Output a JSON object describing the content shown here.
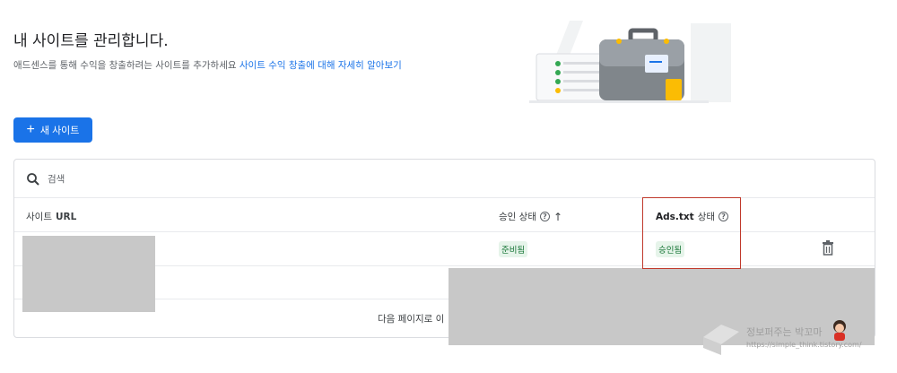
{
  "header": {
    "title": "내 사이트를 관리합니다.",
    "subtitle": "애드센스를 통해 수익을 창출하려는 사이트를 추가하세요",
    "learn_more_link": "사이트 수익 창출에 대해 자세히 알아보기"
  },
  "toolbar": {
    "new_site_icon": "+",
    "new_site_label": "새 사이트"
  },
  "table": {
    "search_placeholder": "검색",
    "columns": {
      "site_url_prefix": "사이트",
      "site_url_suffix": "URL",
      "approval_status": "승인 상태",
      "adstxt_prefix": "Ads.txt",
      "adstxt_suffix": "상태"
    },
    "rows": [
      {
        "site_url": "",
        "approval_status": "준비됨",
        "adstxt_status": "승인됨"
      }
    ],
    "footer": {
      "next_page_label": "다음 페이지로 이"
    }
  },
  "watermark": {
    "name": "정보퍼주는 박꼬마",
    "url": "https://simple_think.tistory.com/"
  },
  "colors": {
    "accent": "#1a73e8",
    "status_green": "#137333",
    "status_green_bg": "#e6f4ea",
    "highlight": "#c0392b"
  },
  "icons": [
    "search-icon",
    "help-icon",
    "sort-arrow-up-icon",
    "delete-icon",
    "plus-icon"
  ]
}
